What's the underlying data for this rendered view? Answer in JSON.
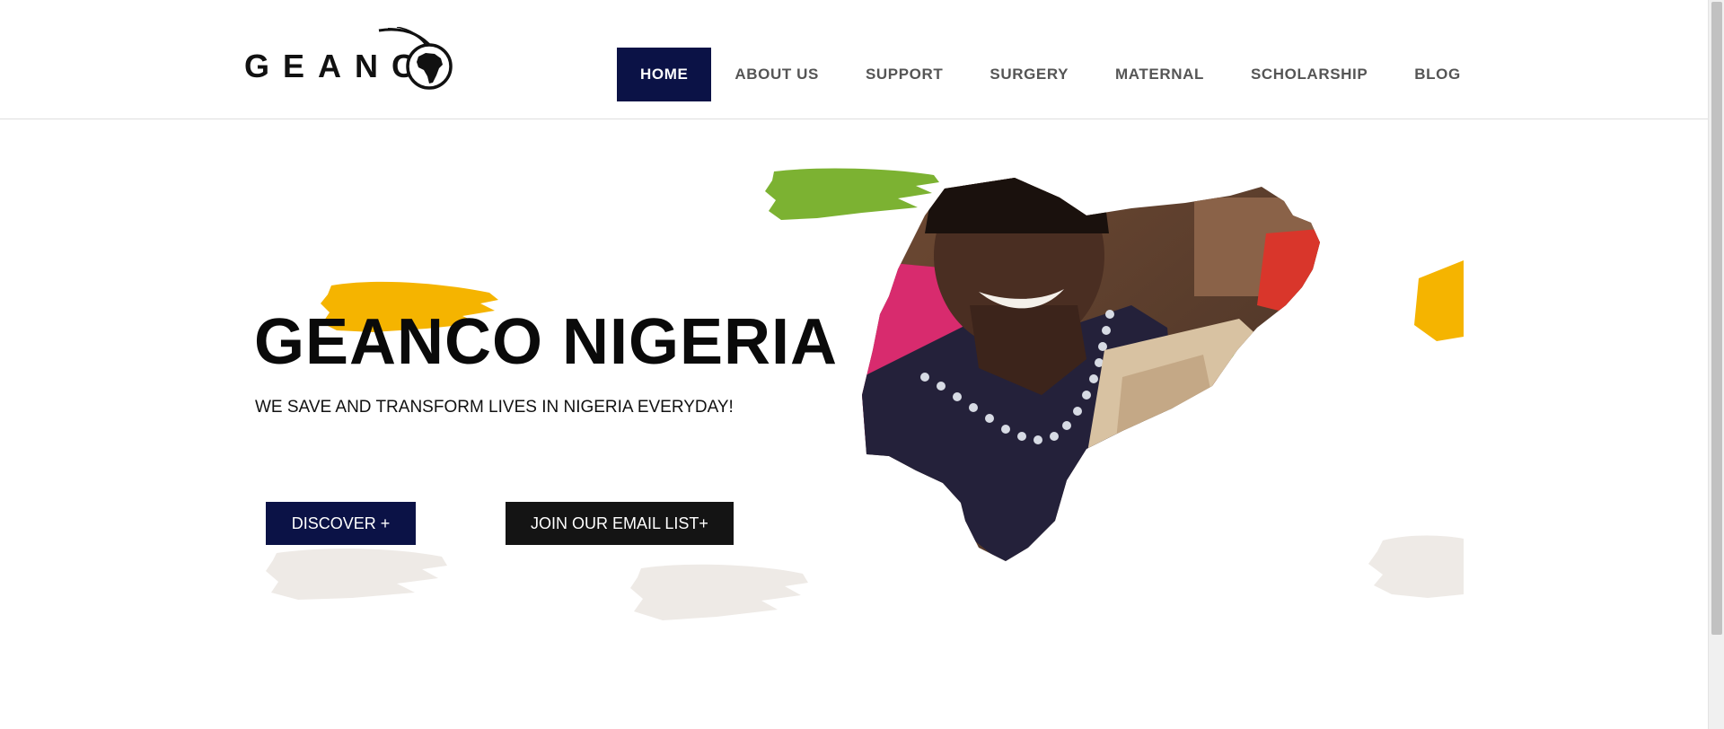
{
  "header": {
    "logo": {
      "text": "GEANCO",
      "icon": "africa-emblem-icon"
    },
    "nav": [
      {
        "label": "HOME",
        "active": true
      },
      {
        "label": "ABOUT US",
        "active": false
      },
      {
        "label": "SUPPORT",
        "active": false
      },
      {
        "label": "SURGERY",
        "active": false
      },
      {
        "label": "MATERNAL",
        "active": false
      },
      {
        "label": "SCHOLARSHIP",
        "active": false
      },
      {
        "label": "BLOG",
        "active": false
      }
    ]
  },
  "hero": {
    "title": "GEANCO NIGERIA",
    "subtitle": "WE SAVE AND TRANSFORM LIVES IN NIGERIA EVERYDAY!",
    "buttons": {
      "discover": "DISCOVER +",
      "email": "JOIN OUR EMAIL LIST+"
    },
    "image": "mother-holding-newborn-in-nigeria-map-shape"
  },
  "colors": {
    "navy": "#0b1246",
    "dark": "#141414",
    "yellow": "#f5b400",
    "green": "#7cb232",
    "light_gray_brush": "#eeeae6"
  }
}
